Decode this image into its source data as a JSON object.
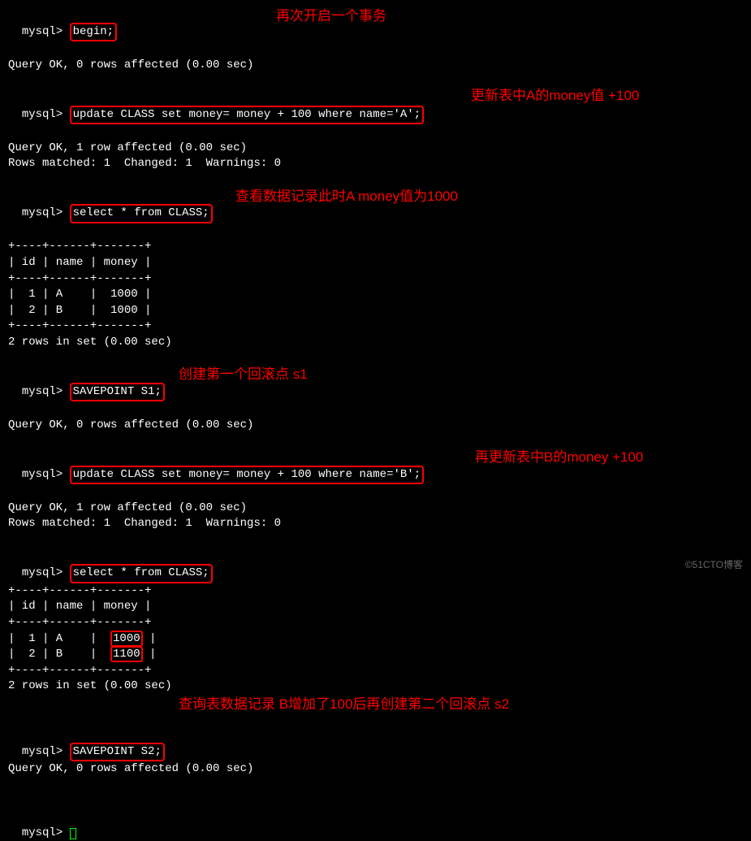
{
  "lines": {
    "l1_prompt": "mysql> ",
    "l1_cmd": "begin;",
    "l2": "Query OK, 0 rows affected (0.00 sec)",
    "annot1": "再次开启一个事务",
    "l3_prompt": "mysql> ",
    "l3_cmd": "update CLASS set money= money + 100 where name='A';",
    "l4": "Query OK, 1 row affected (0.00 sec)",
    "l5": "Rows matched: 1  Changed: 1  Warnings: 0",
    "annot2": "更新表中A的money值 +100",
    "l6_prompt": "mysql> ",
    "l6_cmd": "select * from CLASS;",
    "annot3": "查看数据记录此时A money值为1000",
    "table1_border": "+----+------+-------+",
    "table1_header": "| id | name | money |",
    "table1_row1": "|  1 | A    |  1000 |",
    "table1_row2": "|  2 | B    |  1000 |",
    "table1_summary": "2 rows in set (0.00 sec)",
    "l7_prompt": "mysql> ",
    "l7_cmd": "SAVEPOINT S1;",
    "l8": "Query OK, 0 rows affected (0.00 sec)",
    "annot4": "创建第一个回滚点 s1",
    "l9_prompt": "mysql> ",
    "l9_cmd": "update CLASS set money= money + 100 where name='B';",
    "l10": "Query OK, 1 row affected (0.00 sec)",
    "l11": "Rows matched: 1  Changed: 1  Warnings: 0",
    "annot5": "再更新表中B的money +100",
    "l12_prompt": "mysql> ",
    "l12_cmd": "select * from CLASS;",
    "table2_border": "+----+------+-------+",
    "table2_header": "| id | name | money |",
    "table2_row1_pre": "|  1 | A    |  ",
    "table2_row1_val": "1000",
    "table2_row1_post": " |",
    "table2_row2_pre": "|  2 | B    |  ",
    "table2_row2_val": "1100",
    "table2_row2_post": " |",
    "table2_summary": "2 rows in set (0.00 sec)",
    "annot6": "查询表数据记录 B增加了100后再创建第二个回滚点 s2",
    "l13_prompt": "mysql> ",
    "l13_cmd": "SAVEPOINT S2;",
    "l14": "Query OK, 0 rows affected (0.00 sec)",
    "l15_prompt": "mysql> ",
    "watermark": "©51CTO博客"
  },
  "chart_data": {
    "type": "table",
    "tables": [
      {
        "after": "update CLASS set money=money+100 where name='A'",
        "columns": [
          "id",
          "name",
          "money"
        ],
        "rows": [
          {
            "id": 1,
            "name": "A",
            "money": 1000
          },
          {
            "id": 2,
            "name": "B",
            "money": 1000
          }
        ]
      },
      {
        "after": "update CLASS set money=money+100 where name='B'",
        "columns": [
          "id",
          "name",
          "money"
        ],
        "rows": [
          {
            "id": 1,
            "name": "A",
            "money": 1000
          },
          {
            "id": 2,
            "name": "B",
            "money": 1100
          }
        ]
      }
    ]
  }
}
